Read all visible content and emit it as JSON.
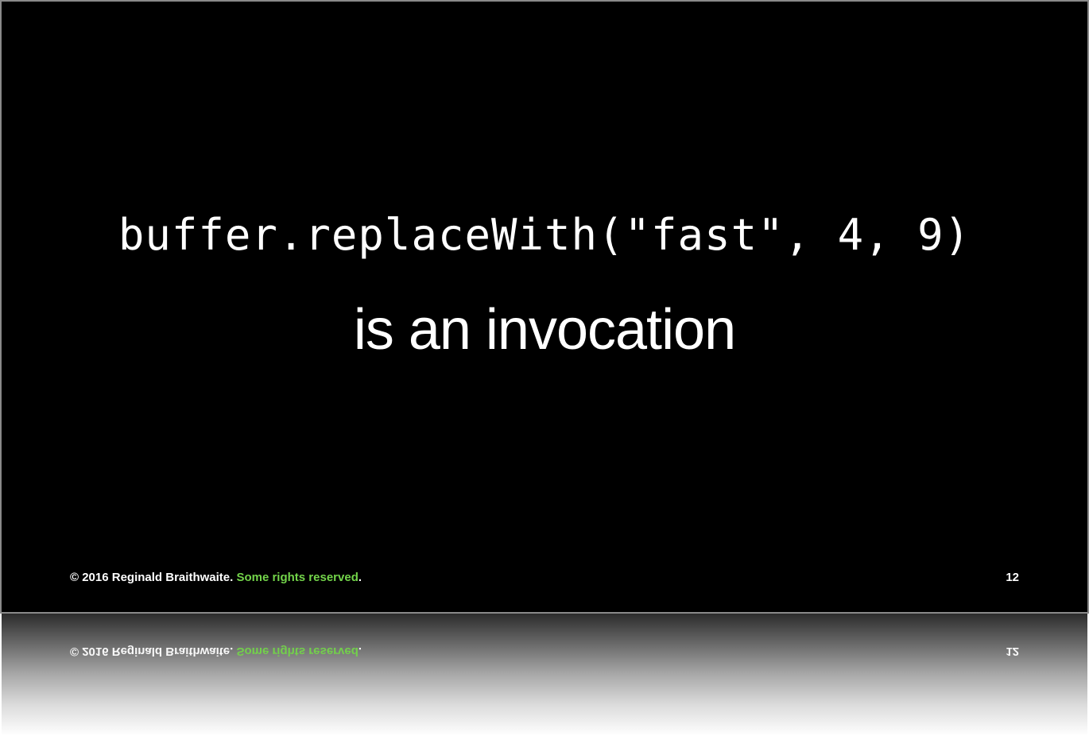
{
  "slide": {
    "code": "buffer.replaceWith(\"fast\", 4, 9)",
    "caption": "is an invocation",
    "footer": {
      "copyright": "© 2016 Reginald Braithwaite. ",
      "rights_link": "Some rights reserved",
      "period": ".",
      "page_number": "12"
    }
  },
  "colors": {
    "background": "#000000",
    "text": "#ffffff",
    "accent_green": "#73d44a"
  }
}
